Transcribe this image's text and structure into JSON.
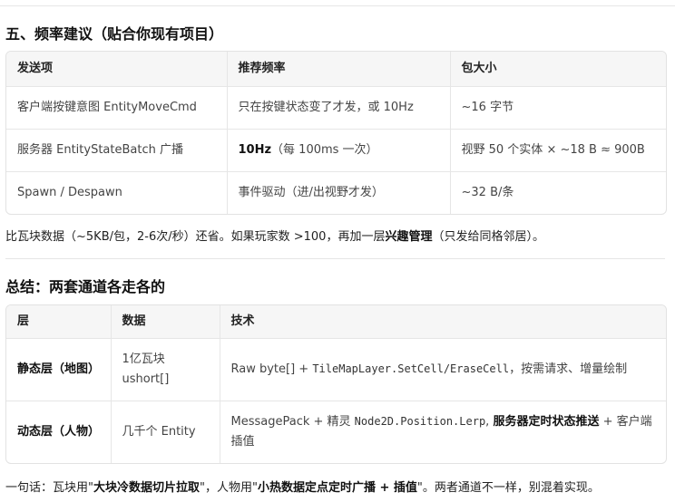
{
  "section5": {
    "heading": "五、频率建议（贴合你现有项目）",
    "headers": [
      "发送项",
      "推荐频率",
      "包大小"
    ],
    "rows": [
      {
        "item": "客户端按键意图 EntityMoveCmd",
        "freq": "只在按键状态变了才发，或 10Hz",
        "size": "~16 字节"
      },
      {
        "item": "服务器 EntityStateBatch 广播",
        "freq_bold": "10Hz",
        "freq_rest": "（每 100ms 一次）",
        "size": "视野 50 个实体 × ~18 B ≈ 900B"
      },
      {
        "item": "Spawn / Despawn",
        "freq": "事件驱动（进/出视野才发）",
        "size": "~32 B/条"
      }
    ],
    "note_pre": "比瓦块数据（~5KB/包，2-6次/秒）还省。如果玩家数 >100，再加一层",
    "note_bold": "兴趣管理",
    "note_post": "（只发给同格邻居）。"
  },
  "summary": {
    "heading": "总结：两套通道各走各的",
    "headers": [
      "层",
      "数据",
      "技术"
    ],
    "rows": [
      {
        "layer": "静态层（地图）",
        "data_line1": "1亿瓦块",
        "data_line2": "ushort[]",
        "tech_a": "Raw byte[] + ",
        "tech_code": "TileMapLayer.SetCell/EraseCell",
        "tech_b": "，按需请求、增量绘制"
      },
      {
        "layer": "动态层（人物）",
        "data": "几千个 Entity",
        "tech_a": "MessagePack + 精灵 ",
        "tech_code": "Node2D.Position.Lerp",
        "tech_b": ", ",
        "tech_bold": "服务器定时状态推送",
        "tech_c": " + 客户端插值"
      }
    ],
    "conclusion_a": "一句话：瓦块用\"",
    "conclusion_b1": "大块冷数据切片拉取",
    "conclusion_c": "\"，人物用\"",
    "conclusion_b2": "小热数据定点定时广播 + 插值",
    "conclusion_d": "\"。两者通道不一样，别混着实现。"
  }
}
